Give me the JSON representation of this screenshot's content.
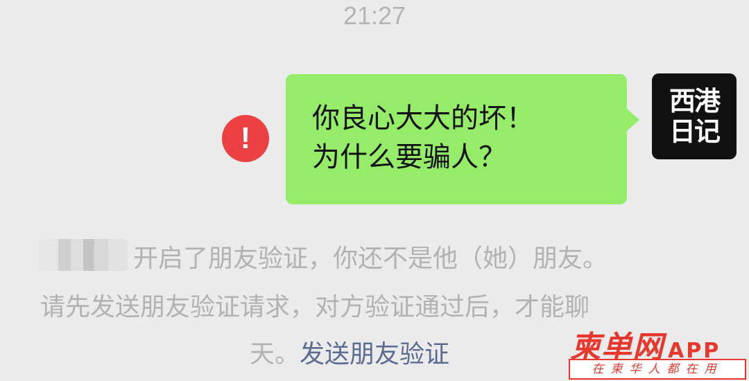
{
  "chat": {
    "time": "21:27",
    "message": {
      "line1": "你良心大大的坏！",
      "line2": "为什么要骗人？",
      "status_icon": "red-exclamation-icon"
    },
    "avatar": {
      "line1": "西港",
      "line2": "日记"
    }
  },
  "system_notice": {
    "line1": "开启了朋友验证，你还不是他（她）朋友。",
    "line2": "请先发送朋友验证请求，对方验证通过后，才能聊",
    "line3_prefix": "天。",
    "link": "发送朋友验证"
  },
  "watermark": {
    "brand": "柬单网",
    "app": "APP",
    "slogan": "在柬华人都在用"
  },
  "colors": {
    "bubble": "#95ec69",
    "error": "#ec4043",
    "link": "#5b6b92",
    "watermark": "#e8372c"
  }
}
